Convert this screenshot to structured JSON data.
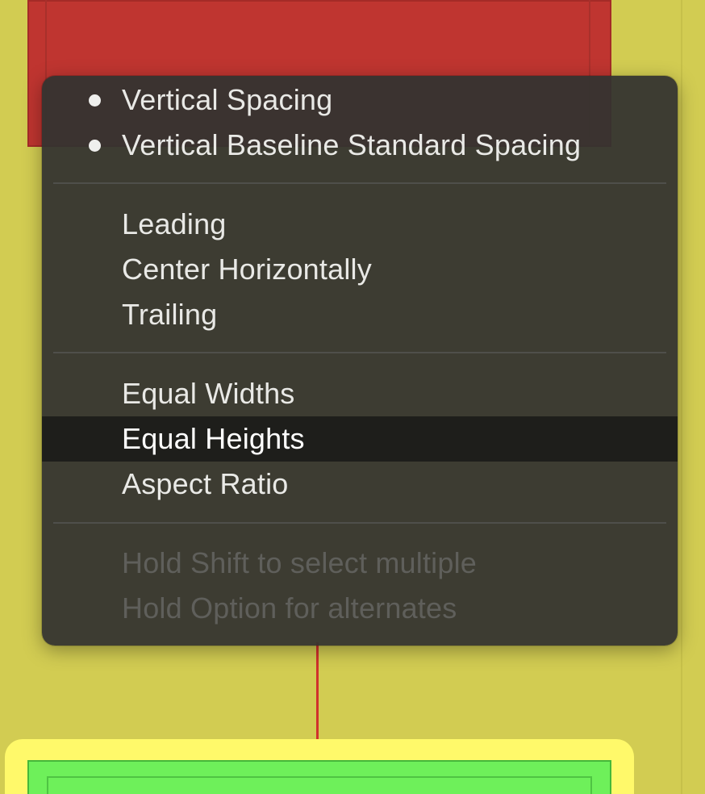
{
  "colors": {
    "canvas_background": "#d2cc52",
    "top_view": "#bf3530",
    "bottom_view": "#6ef05a",
    "selection_highlight": "#fff96a",
    "constraint": "#d0322c",
    "menu_background": "#333330",
    "menu_highlight": "#1e1e1b"
  },
  "menu": {
    "sections": [
      {
        "items": [
          {
            "label": "Vertical Spacing",
            "checked": true
          },
          {
            "label": "Vertical Baseline Standard Spacing",
            "checked": true
          }
        ]
      },
      {
        "items": [
          {
            "label": "Leading"
          },
          {
            "label": "Center Horizontally"
          },
          {
            "label": "Trailing"
          }
        ]
      },
      {
        "items": [
          {
            "label": "Equal Widths"
          },
          {
            "label": "Equal Heights",
            "highlighted": true
          },
          {
            "label": "Aspect Ratio"
          }
        ]
      },
      {
        "items": [
          {
            "label": "Hold Shift to select multiple",
            "disabled": true
          },
          {
            "label": "Hold Option for alternates",
            "disabled": true
          }
        ]
      }
    ]
  }
}
